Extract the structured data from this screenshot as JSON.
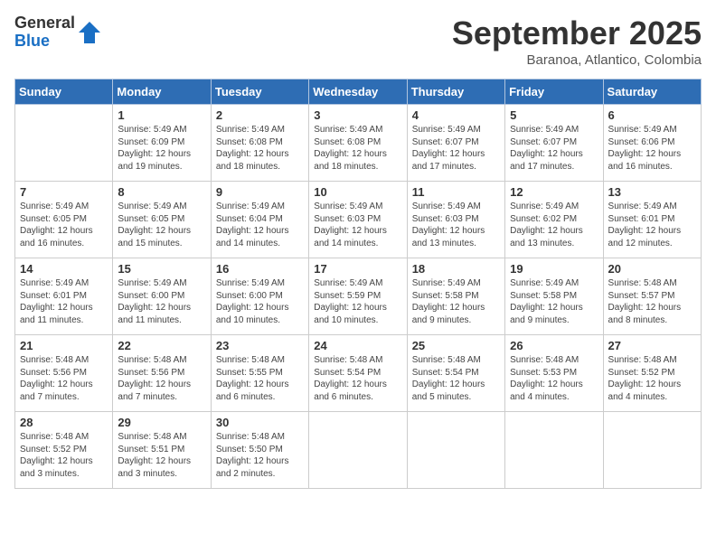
{
  "logo": {
    "general": "General",
    "blue": "Blue"
  },
  "title": "September 2025",
  "location": "Baranoa, Atlantico, Colombia",
  "weekdays": [
    "Sunday",
    "Monday",
    "Tuesday",
    "Wednesday",
    "Thursday",
    "Friday",
    "Saturday"
  ],
  "weeks": [
    [
      {
        "day": "",
        "info": ""
      },
      {
        "day": "1",
        "info": "Sunrise: 5:49 AM\nSunset: 6:09 PM\nDaylight: 12 hours\nand 19 minutes."
      },
      {
        "day": "2",
        "info": "Sunrise: 5:49 AM\nSunset: 6:08 PM\nDaylight: 12 hours\nand 18 minutes."
      },
      {
        "day": "3",
        "info": "Sunrise: 5:49 AM\nSunset: 6:08 PM\nDaylight: 12 hours\nand 18 minutes."
      },
      {
        "day": "4",
        "info": "Sunrise: 5:49 AM\nSunset: 6:07 PM\nDaylight: 12 hours\nand 17 minutes."
      },
      {
        "day": "5",
        "info": "Sunrise: 5:49 AM\nSunset: 6:07 PM\nDaylight: 12 hours\nand 17 minutes."
      },
      {
        "day": "6",
        "info": "Sunrise: 5:49 AM\nSunset: 6:06 PM\nDaylight: 12 hours\nand 16 minutes."
      }
    ],
    [
      {
        "day": "7",
        "info": "Sunrise: 5:49 AM\nSunset: 6:05 PM\nDaylight: 12 hours\nand 16 minutes."
      },
      {
        "day": "8",
        "info": "Sunrise: 5:49 AM\nSunset: 6:05 PM\nDaylight: 12 hours\nand 15 minutes."
      },
      {
        "day": "9",
        "info": "Sunrise: 5:49 AM\nSunset: 6:04 PM\nDaylight: 12 hours\nand 14 minutes."
      },
      {
        "day": "10",
        "info": "Sunrise: 5:49 AM\nSunset: 6:03 PM\nDaylight: 12 hours\nand 14 minutes."
      },
      {
        "day": "11",
        "info": "Sunrise: 5:49 AM\nSunset: 6:03 PM\nDaylight: 12 hours\nand 13 minutes."
      },
      {
        "day": "12",
        "info": "Sunrise: 5:49 AM\nSunset: 6:02 PM\nDaylight: 12 hours\nand 13 minutes."
      },
      {
        "day": "13",
        "info": "Sunrise: 5:49 AM\nSunset: 6:01 PM\nDaylight: 12 hours\nand 12 minutes."
      }
    ],
    [
      {
        "day": "14",
        "info": "Sunrise: 5:49 AM\nSunset: 6:01 PM\nDaylight: 12 hours\nand 11 minutes."
      },
      {
        "day": "15",
        "info": "Sunrise: 5:49 AM\nSunset: 6:00 PM\nDaylight: 12 hours\nand 11 minutes."
      },
      {
        "day": "16",
        "info": "Sunrise: 5:49 AM\nSunset: 6:00 PM\nDaylight: 12 hours\nand 10 minutes."
      },
      {
        "day": "17",
        "info": "Sunrise: 5:49 AM\nSunset: 5:59 PM\nDaylight: 12 hours\nand 10 minutes."
      },
      {
        "day": "18",
        "info": "Sunrise: 5:49 AM\nSunset: 5:58 PM\nDaylight: 12 hours\nand 9 minutes."
      },
      {
        "day": "19",
        "info": "Sunrise: 5:49 AM\nSunset: 5:58 PM\nDaylight: 12 hours\nand 9 minutes."
      },
      {
        "day": "20",
        "info": "Sunrise: 5:48 AM\nSunset: 5:57 PM\nDaylight: 12 hours\nand 8 minutes."
      }
    ],
    [
      {
        "day": "21",
        "info": "Sunrise: 5:48 AM\nSunset: 5:56 PM\nDaylight: 12 hours\nand 7 minutes."
      },
      {
        "day": "22",
        "info": "Sunrise: 5:48 AM\nSunset: 5:56 PM\nDaylight: 12 hours\nand 7 minutes."
      },
      {
        "day": "23",
        "info": "Sunrise: 5:48 AM\nSunset: 5:55 PM\nDaylight: 12 hours\nand 6 minutes."
      },
      {
        "day": "24",
        "info": "Sunrise: 5:48 AM\nSunset: 5:54 PM\nDaylight: 12 hours\nand 6 minutes."
      },
      {
        "day": "25",
        "info": "Sunrise: 5:48 AM\nSunset: 5:54 PM\nDaylight: 12 hours\nand 5 minutes."
      },
      {
        "day": "26",
        "info": "Sunrise: 5:48 AM\nSunset: 5:53 PM\nDaylight: 12 hours\nand 4 minutes."
      },
      {
        "day": "27",
        "info": "Sunrise: 5:48 AM\nSunset: 5:52 PM\nDaylight: 12 hours\nand 4 minutes."
      }
    ],
    [
      {
        "day": "28",
        "info": "Sunrise: 5:48 AM\nSunset: 5:52 PM\nDaylight: 12 hours\nand 3 minutes."
      },
      {
        "day": "29",
        "info": "Sunrise: 5:48 AM\nSunset: 5:51 PM\nDaylight: 12 hours\nand 3 minutes."
      },
      {
        "day": "30",
        "info": "Sunrise: 5:48 AM\nSunset: 5:50 PM\nDaylight: 12 hours\nand 2 minutes."
      },
      {
        "day": "",
        "info": ""
      },
      {
        "day": "",
        "info": ""
      },
      {
        "day": "",
        "info": ""
      },
      {
        "day": "",
        "info": ""
      }
    ]
  ]
}
